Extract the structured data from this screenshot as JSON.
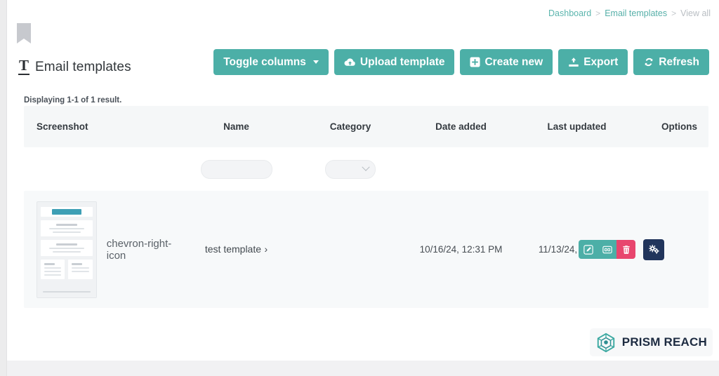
{
  "breadcrumb": {
    "items": [
      {
        "label": "Dashboard",
        "current": false
      },
      {
        "label": "Email templates",
        "current": false
      },
      {
        "label": "View all",
        "current": true
      }
    ],
    "separator": ">"
  },
  "header": {
    "title": "Email templates",
    "title_icon": "text-format-icon",
    "ribbon_icon": "bookmark-icon"
  },
  "toolbar": {
    "buttons": [
      {
        "label": "Toggle columns",
        "icon": "chevron-down-icon",
        "name": "toggle-columns-button"
      },
      {
        "label": "Upload template",
        "icon": "cloud-upload-icon",
        "name": "upload-template-button"
      },
      {
        "label": "Create new",
        "icon": "plus-square-icon",
        "name": "create-new-button"
      },
      {
        "label": "Export",
        "icon": "export-icon",
        "name": "export-button"
      },
      {
        "label": "Refresh",
        "icon": "refresh-icon",
        "name": "refresh-button"
      }
    ],
    "accent_color": "#4cafa7"
  },
  "results": {
    "count_text": "Displaying 1-1 of 1 result."
  },
  "table": {
    "headers": {
      "screenshot": "Screenshot",
      "name": "Name",
      "category": "Category",
      "date_added": "Date added",
      "last_updated": "Last updated",
      "options": "Options"
    },
    "filters": {
      "name_value": "",
      "name_placeholder": "",
      "category_value": "",
      "category_icon": "chevron-down-icon"
    },
    "rows": [
      {
        "screenshot_alt": "email-template-thumbnail",
        "expand_icon": "chevron-right-icon",
        "name": "test template",
        "name_chevron": "›",
        "category": "",
        "date_added": "10/16/24, 12:31 PM",
        "last_updated": "11/13/24, 1:13 PM",
        "actions": [
          {
            "name": "edit-template-button",
            "icon": "pencil-square-icon",
            "color": "#4cafa7"
          },
          {
            "name": "duplicate-template-button",
            "icon": "cc-box-icon",
            "color": "#4cafa7"
          },
          {
            "name": "delete-template-button",
            "icon": "trash-icon",
            "color": "#e8466e"
          },
          {
            "name": "template-settings-button",
            "icon": "cogs-icon",
            "color": "#21355c"
          }
        ]
      }
    ]
  },
  "logo": {
    "text": "PRISM REACH",
    "icon": "prism-logo-icon",
    "color": "#3aa8a0"
  }
}
